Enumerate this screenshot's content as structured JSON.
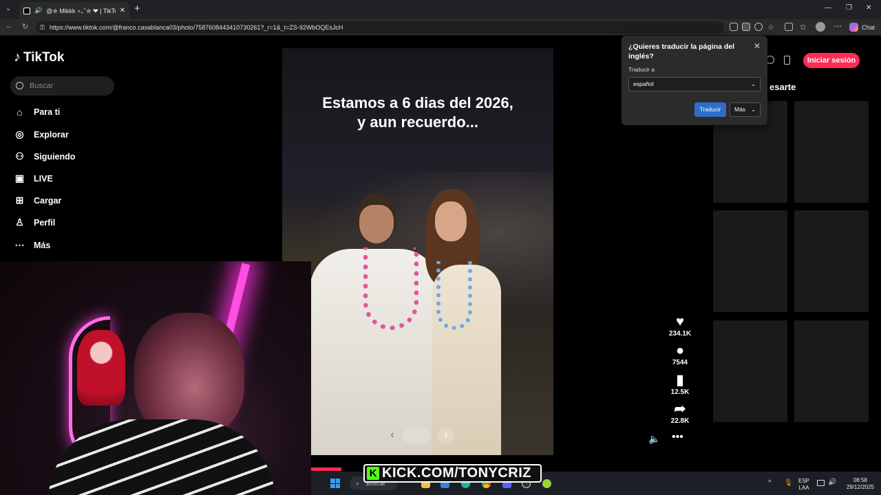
{
  "browser": {
    "tab_title": "@✮ Mikkk ⋆｡˚✮ ❤ | TikTok",
    "url": "https://www.tiktok.com/@franco.casablanca03/photo/7587608443410730261?_r=1&_t=ZS-92WbOQEsJcH",
    "copilot_label": "Chat"
  },
  "tiktok": {
    "logo_text": "TikTok",
    "search_placeholder": "Buscar",
    "nav": [
      {
        "label": "Para ti",
        "icon": "home-icon"
      },
      {
        "label": "Explorar",
        "icon": "compass-icon"
      },
      {
        "label": "Siguiendo",
        "icon": "following-icon"
      },
      {
        "label": "LIVE",
        "icon": "live-icon"
      },
      {
        "label": "Cargar",
        "icon": "upload-icon"
      },
      {
        "label": "Perfil",
        "icon": "profile-icon"
      },
      {
        "label": "Más",
        "icon": "more-icon"
      }
    ],
    "caption_line1": "Estamos a 6 dias del 2026,",
    "caption_line2": "y aun recuerdo...",
    "likes": "234.1K",
    "comments": "7544",
    "bookmarks": "12.5K",
    "shares": "22.8K",
    "login_button": "Iniciar sesión",
    "right_title": "esarte",
    "accent_color": "#fe2c55"
  },
  "translate_popup": {
    "question": "¿Quieres traducir la página del inglés?",
    "translate_to_label": "Traducir a",
    "language_selected": "español",
    "translate_button": "Traducir",
    "more_button": "Más"
  },
  "stream": {
    "kick_url": "KICK.COM/TONYCRIZ",
    "kick_color": "#53fc18"
  },
  "taskbar": {
    "search_placeholder": "Buscar",
    "lang_line1": "ESP",
    "lang_line2": "LAA",
    "time": "08:58",
    "date": "29/12/2025"
  }
}
